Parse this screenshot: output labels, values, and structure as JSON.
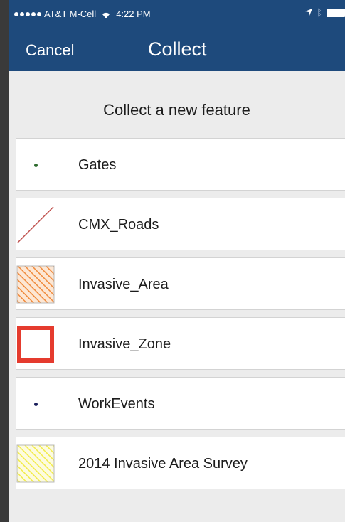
{
  "status_bar": {
    "carrier": "AT&T M-Cell",
    "time": "4:22 PM"
  },
  "nav": {
    "cancel_label": "Cancel",
    "title": "Collect"
  },
  "section_title": "Collect a new feature",
  "features": [
    {
      "label": "Gates",
      "icon": "point-symbol-icon",
      "color": "#2e6b2e"
    },
    {
      "label": "CMX_Roads",
      "icon": "line-symbol-icon",
      "color": "#c0504d"
    },
    {
      "label": "Invasive_Area",
      "icon": "hatched-polygon-icon",
      "color": "#f08a3c"
    },
    {
      "label": "Invasive_Zone",
      "icon": "outlined-polygon-icon",
      "color": "#e53b2e"
    },
    {
      "label": "WorkEvents",
      "icon": "point-symbol-icon",
      "color": "#1a1f5c"
    },
    {
      "label": "2014 Invasive Area Survey",
      "icon": "hatched-polygon-icon",
      "color": "#f2ec4a"
    }
  ]
}
